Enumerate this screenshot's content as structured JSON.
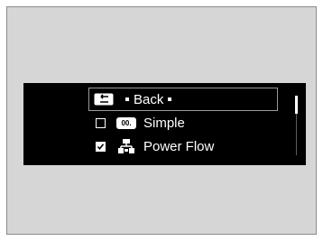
{
  "menu": {
    "back": {
      "label": "Back",
      "icon": "back-arrow-icon"
    },
    "items": [
      {
        "label": "Simple",
        "icon_text": "00.",
        "checked": false
      },
      {
        "label": "Power Flow",
        "checked": true
      }
    ]
  }
}
